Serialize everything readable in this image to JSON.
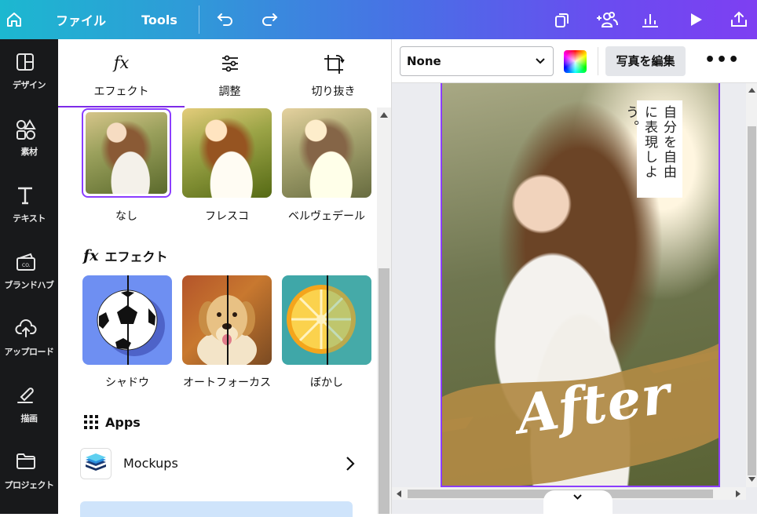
{
  "topbar": {
    "file_label": "ファイル",
    "tools_label": "Tools"
  },
  "rail": {
    "items": [
      {
        "label": "デザイン",
        "icon": "layout-icon"
      },
      {
        "label": "素材",
        "icon": "shapes-icon"
      },
      {
        "label": "テキスト",
        "icon": "text-icon"
      },
      {
        "label": "ブランドハブ",
        "icon": "brand-icon"
      },
      {
        "label": "アップロード",
        "icon": "upload-icon"
      },
      {
        "label": "描画",
        "icon": "draw-icon"
      },
      {
        "label": "プロジェクト",
        "icon": "folder-icon"
      }
    ]
  },
  "panel": {
    "tabs": [
      {
        "label": "エフェクト",
        "icon": "fx-icon",
        "glyph": "fx"
      },
      {
        "label": "調整",
        "icon": "sliders-icon"
      },
      {
        "label": "切り抜き",
        "icon": "crop-icon"
      }
    ],
    "filters": [
      {
        "label": "なし"
      },
      {
        "label": "フレスコ"
      },
      {
        "label": "ベルヴェデール"
      }
    ],
    "effects_title": "エフェクト",
    "effects_glyph": "fx",
    "effects": [
      {
        "label": "シャドウ"
      },
      {
        "label": "オートフォーカス"
      },
      {
        "label": "ぼかし"
      }
    ],
    "apps_title": "Apps",
    "mockups_label": "Mockups"
  },
  "canvas": {
    "select_value": "None",
    "edit_photo_label": "写真を編集",
    "more_label": "•••",
    "vertical_text": "自分を自由に表現しよう。",
    "after_text": "After"
  }
}
